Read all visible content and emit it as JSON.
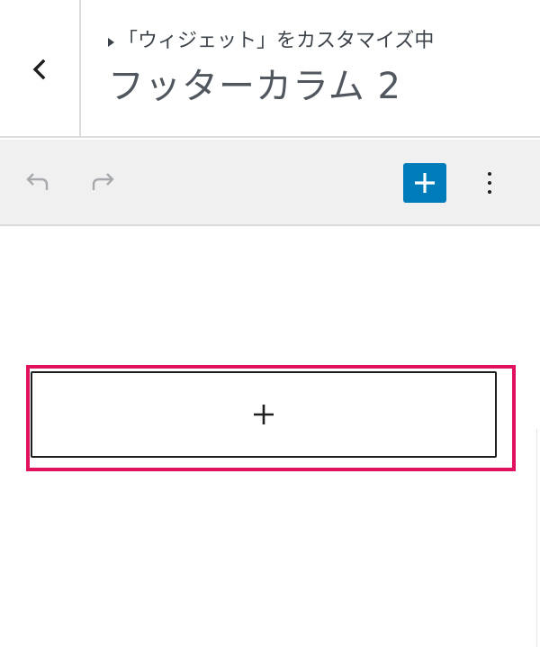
{
  "header": {
    "back_icon": "chevron-left-icon",
    "breadcrumb": "「ウィジェット」をカスタマイズ中",
    "title": "フッターカラム 2"
  },
  "toolbar": {
    "undo_icon": "undo-icon",
    "redo_icon": "redo-icon",
    "add_block_icon": "plus-icon",
    "more_icon": "more-vertical-icon",
    "accent_color": "#007cba"
  },
  "content": {
    "appender_icon": "plus-icon",
    "highlight_color": "#e0115f"
  }
}
